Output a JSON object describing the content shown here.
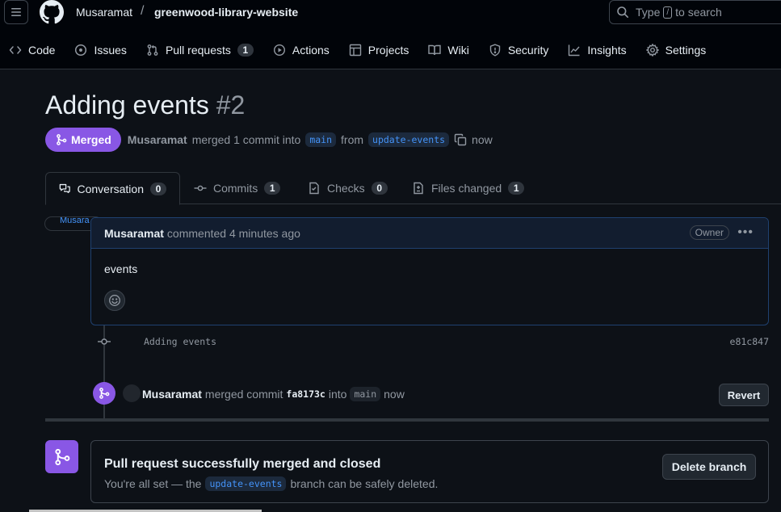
{
  "header": {
    "owner": "Musaramat",
    "separator": "/",
    "repo": "greenwood-library-website",
    "search": {
      "prefix": "Type",
      "key": "/",
      "suffix": "to search"
    }
  },
  "nav": {
    "items": [
      {
        "label": "Code",
        "icon": "code-icon"
      },
      {
        "label": "Issues",
        "icon": "issue-icon"
      },
      {
        "label": "Pull requests",
        "icon": "pull-request-icon",
        "count": "1"
      },
      {
        "label": "Actions",
        "icon": "play-icon"
      },
      {
        "label": "Projects",
        "icon": "table-icon"
      },
      {
        "label": "Wiki",
        "icon": "book-icon"
      },
      {
        "label": "Security",
        "icon": "shield-icon"
      },
      {
        "label": "Insights",
        "icon": "graph-icon"
      },
      {
        "label": "Settings",
        "icon": "gear-icon"
      }
    ]
  },
  "pr": {
    "title": "Adding events",
    "number": "#2",
    "state": "Merged",
    "author": "Musaramat",
    "meta_merged": "merged 1 commit into",
    "base_branch": "main",
    "meta_from": "from",
    "head_branch": "update-events",
    "time": "now"
  },
  "tabs": [
    {
      "label": "Conversation",
      "count": "0",
      "icon": "comment-discussion-icon"
    },
    {
      "label": "Commits",
      "count": "1",
      "icon": "commit-icon"
    },
    {
      "label": "Checks",
      "count": "0",
      "icon": "checklist-icon"
    },
    {
      "label": "Files changed",
      "count": "1",
      "icon": "file-diff-icon"
    }
  ],
  "comment": {
    "avatar_alt": "Musara",
    "author": "Musaramat",
    "action": "commented 4 minutes ago",
    "badge": "Owner",
    "body": "events"
  },
  "commit": {
    "message": "Adding events",
    "sha": "e81c847"
  },
  "merge_event": {
    "author": "Musaramat",
    "text1": "merged commit",
    "sha": "fa8173c",
    "text2": "into",
    "branch": "main",
    "time": "now",
    "revert_label": "Revert"
  },
  "merged_box": {
    "title": "Pull request successfully merged and closed",
    "desc_prefix": "You're all set — the",
    "branch": "update-events",
    "desc_suffix": "branch can be safely deleted.",
    "delete_label": "Delete branch"
  },
  "colors": {
    "merged": "#8957e5",
    "background": "#0d1117",
    "link": "#4493f8"
  }
}
